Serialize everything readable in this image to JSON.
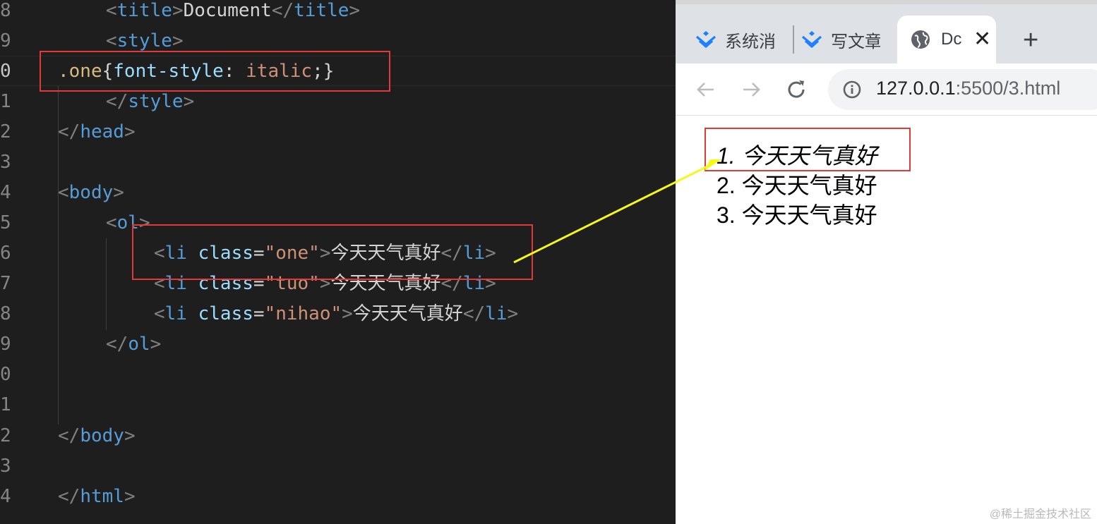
{
  "editor": {
    "lines": [
      {
        "num": "8"
      },
      {
        "num": "9"
      },
      {
        "num": "0"
      },
      {
        "num": "1"
      },
      {
        "num": "2"
      },
      {
        "num": "3"
      },
      {
        "num": "4"
      },
      {
        "num": "5"
      },
      {
        "num": "6"
      },
      {
        "num": "7"
      },
      {
        "num": "8"
      },
      {
        "num": "9"
      },
      {
        "num": "0"
      },
      {
        "num": "1"
      },
      {
        "num": "2"
      },
      {
        "num": "3"
      },
      {
        "num": "4"
      }
    ],
    "code": {
      "l8_tag": "title",
      "l8_text": "Document",
      "l9_tag": "style",
      "l10_selector": ".one",
      "l10_prop": "font-style",
      "l10_value": "italic",
      "l11_tag": "style",
      "l12_tag": "head",
      "l14_tag": "body",
      "l15_tag": "ol",
      "li_tag": "li",
      "attr": "class",
      "l16_class": "\"one\"",
      "l17_class": "\"tuo\"",
      "l18_class": "\"nihao\"",
      "li_text": "今天天气真好",
      "l19_tag": "ol",
      "l22_tag": "body",
      "l24_tag": "html"
    }
  },
  "browser": {
    "tabs": [
      {
        "label": "系统消"
      },
      {
        "label": "写文章"
      },
      {
        "label": "Dc"
      }
    ],
    "address": {
      "host": "127.0.0.1",
      "path": ":5500/3.html"
    },
    "list_items": [
      {
        "marker": "1.",
        "text": "今天天气真好"
      },
      {
        "marker": "2.",
        "text": "今天天气真好"
      },
      {
        "marker": "3.",
        "text": "今天天气真好"
      }
    ]
  },
  "watermark": "@稀土掘金技术社区",
  "colors": {
    "annotation_box": "#e03a3a",
    "arrow": "#f7f71a",
    "editor_bg": "#1e1e1e"
  }
}
